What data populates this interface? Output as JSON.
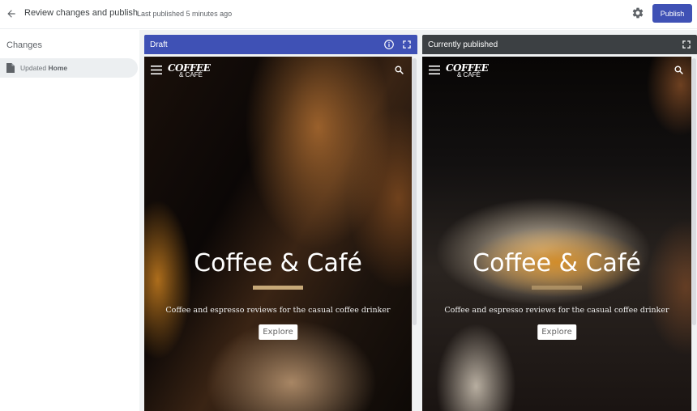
{
  "header": {
    "title": "Review changes and publish",
    "subtitle": "Last published 5 minutes ago",
    "publish_label": "Publish",
    "accent_color": "#3f51b5"
  },
  "sidebar": {
    "title": "Changes",
    "items": [
      {
        "prefix": "Updated",
        "page": "Home",
        "icon": "document-icon"
      }
    ]
  },
  "panels": {
    "draft": {
      "label": "Draft",
      "icons": [
        "info-icon",
        "fullscreen-icon"
      ]
    },
    "published": {
      "label": "Currently published",
      "icons": [
        "fullscreen-icon"
      ]
    }
  },
  "site": {
    "logo_line1": "COFFEE",
    "logo_line2": "& CAFÉ",
    "hero_title": "Coffee & Café",
    "tagline": "Coffee and espresso reviews for the casual coffee drinker",
    "cta": "Explore"
  }
}
